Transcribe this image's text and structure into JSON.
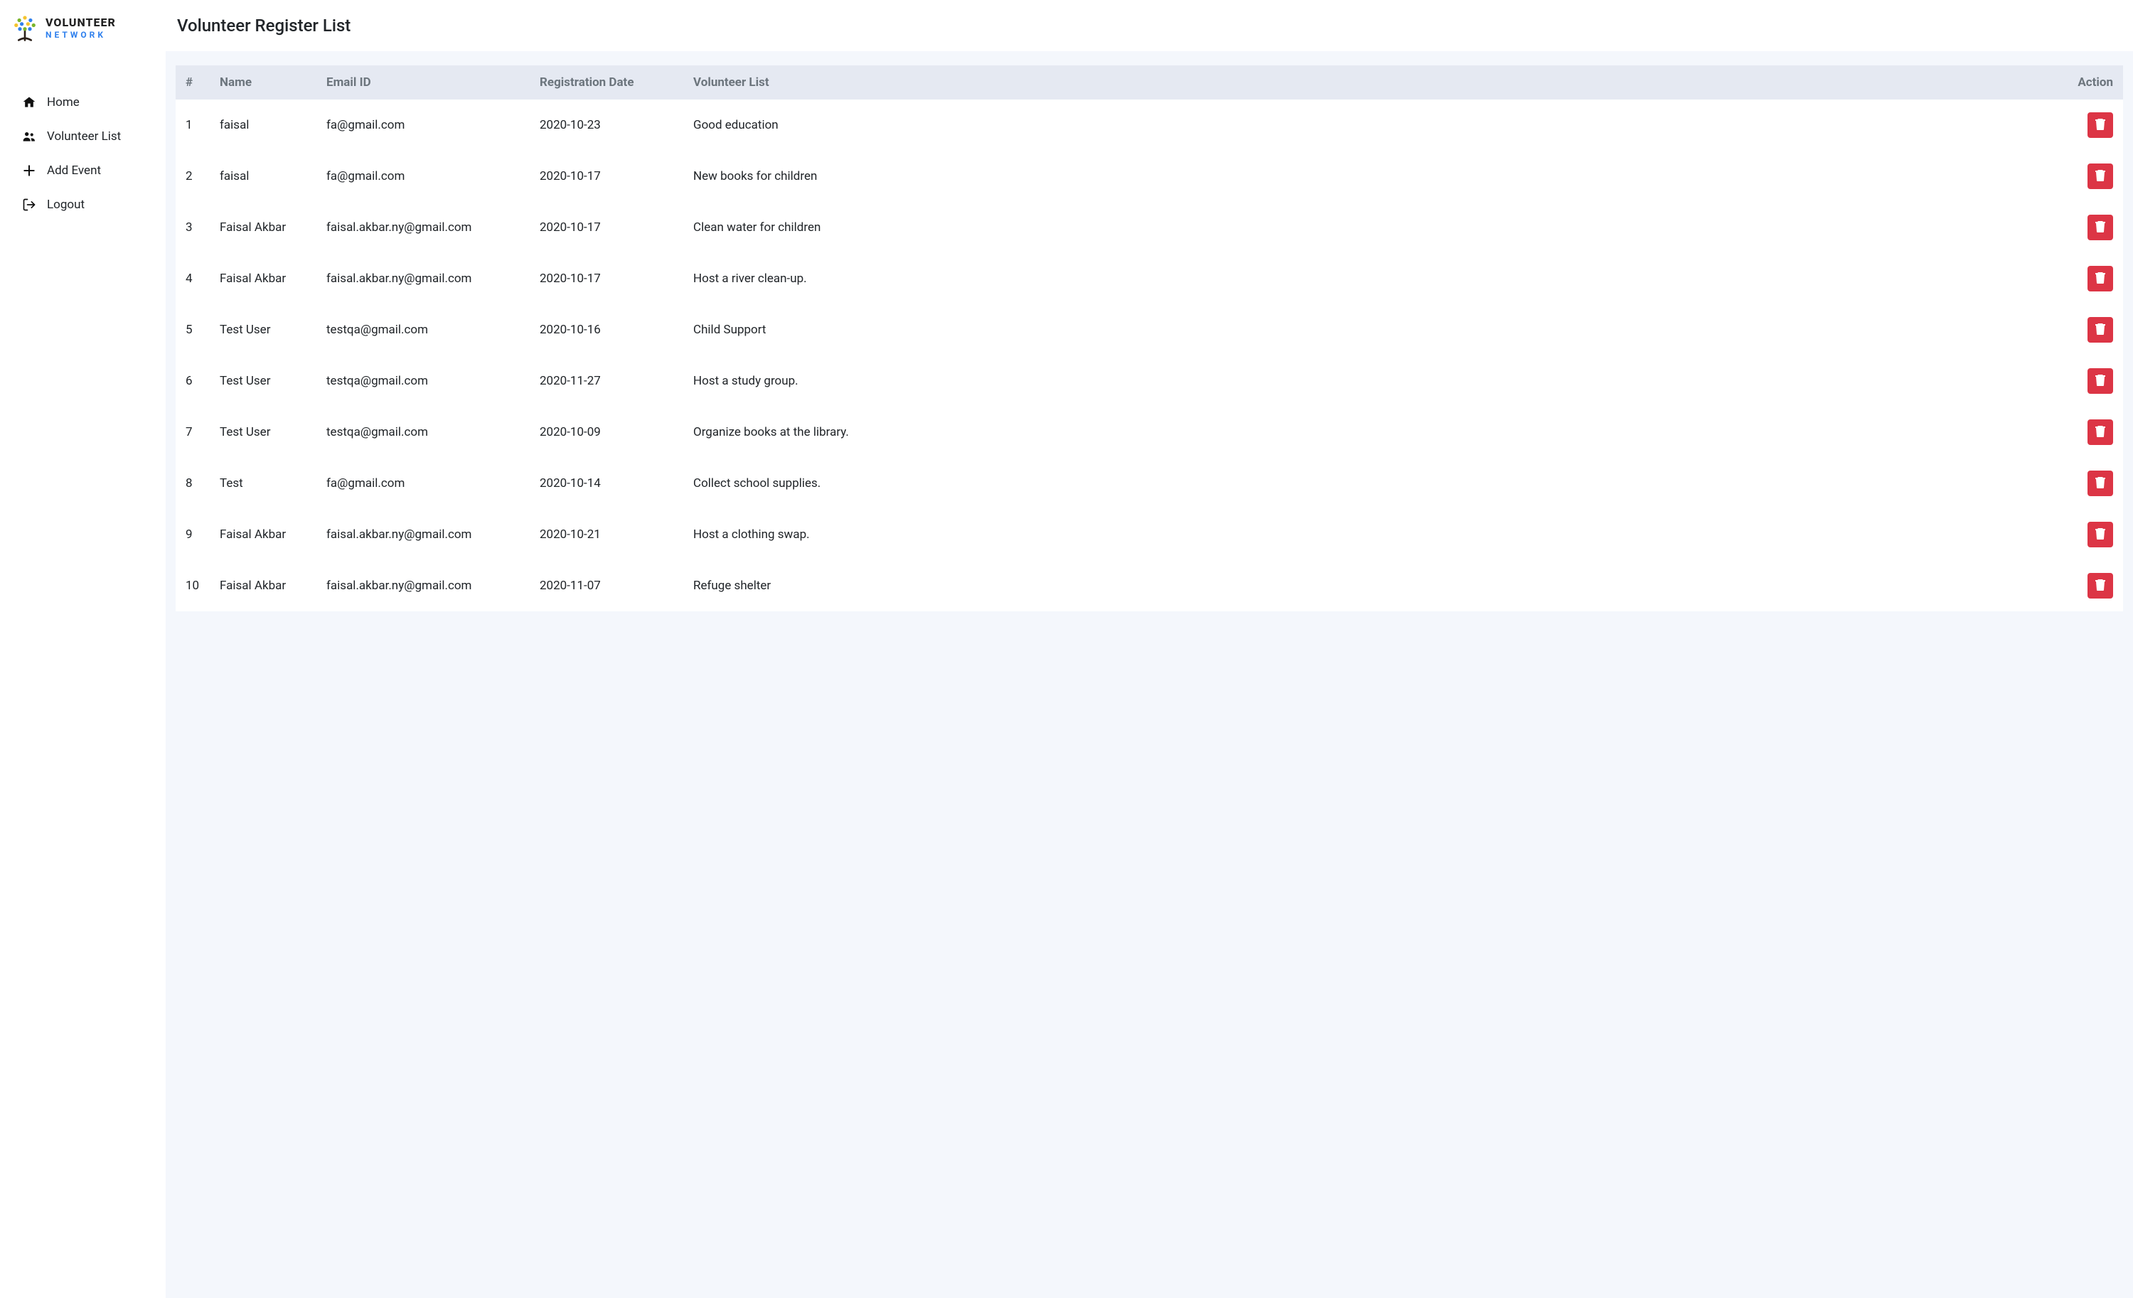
{
  "brand": {
    "line1": "VOLUNTEER",
    "line2": "NETWORK"
  },
  "page_title": "Volunteer Register List",
  "sidebar": {
    "items": [
      {
        "label": "Home",
        "icon": "home-icon"
      },
      {
        "label": "Volunteer List",
        "icon": "users-icon"
      },
      {
        "label": "Add Event",
        "icon": "plus-icon"
      },
      {
        "label": "Logout",
        "icon": "logout-icon"
      }
    ]
  },
  "table": {
    "headers": {
      "num": "#",
      "name": "Name",
      "email": "Email ID",
      "date": "Registration Date",
      "list": "Volunteer List",
      "action": "Action"
    },
    "rows": [
      {
        "num": "1",
        "name": "faisal",
        "email": "fa@gmail.com",
        "date": "2020-10-23",
        "list": "Good education"
      },
      {
        "num": "2",
        "name": "faisal",
        "email": "fa@gmail.com",
        "date": "2020-10-17",
        "list": "New books for children"
      },
      {
        "num": "3",
        "name": "Faisal Akbar",
        "email": "faisal.akbar.ny@gmail.com",
        "date": "2020-10-17",
        "list": "Clean water for children"
      },
      {
        "num": "4",
        "name": "Faisal Akbar",
        "email": "faisal.akbar.ny@gmail.com",
        "date": "2020-10-17",
        "list": "Host a river clean-up."
      },
      {
        "num": "5",
        "name": "Test User",
        "email": "testqa@gmail.com",
        "date": "2020-10-16",
        "list": "Child Support"
      },
      {
        "num": "6",
        "name": "Test User",
        "email": "testqa@gmail.com",
        "date": "2020-11-27",
        "list": "Host a study group."
      },
      {
        "num": "7",
        "name": "Test User",
        "email": "testqa@gmail.com",
        "date": "2020-10-09",
        "list": "Organize books at the library."
      },
      {
        "num": "8",
        "name": "Test",
        "email": "fa@gmail.com",
        "date": "2020-10-14",
        "list": "Collect school supplies."
      },
      {
        "num": "9",
        "name": "Faisal Akbar",
        "email": "faisal.akbar.ny@gmail.com",
        "date": "2020-10-21",
        "list": "Host a clothing swap."
      },
      {
        "num": "10",
        "name": "Faisal Akbar",
        "email": "faisal.akbar.ny@gmail.com",
        "date": "2020-11-07",
        "list": "Refuge shelter"
      }
    ]
  }
}
